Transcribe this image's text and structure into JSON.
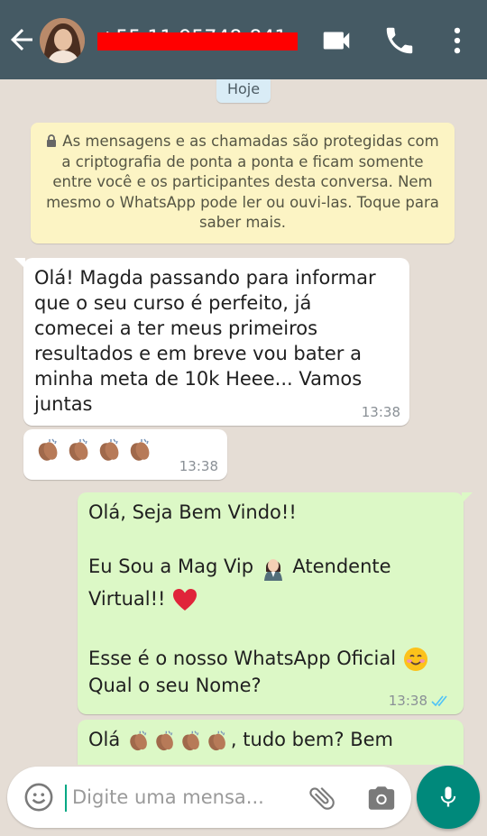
{
  "header": {
    "contact_name": "+55 11 95748-841...",
    "icons": [
      "back-arrow-icon",
      "video-call-icon",
      "phone-icon",
      "more-vert-icon"
    ]
  },
  "chat": {
    "date_chip": "Hoje",
    "encryption_notice": "As mensagens e as chamadas são protegidas com a criptografia de ponta a ponta e ficam somente entre você e os participantes desta conversa. Nem mesmo o WhatsApp pode ler ou ouvi-las. Toque para saber mais.",
    "messages": [
      {
        "direction": "incoming",
        "lines": [
          "Olá! Magda passando para informar",
          "que o seu curso é perfeito, já",
          "comecei a ter meus primeiros",
          "resultados e em breve vou bater a",
          "minha meta de 10k Heee... Vamos",
          "juntas"
        ],
        "time": "13:38"
      },
      {
        "direction": "incoming",
        "emojis": [
          "clapping-hands",
          "clapping-hands",
          "clapping-hands",
          "clapping-hands"
        ],
        "time": "13:38"
      },
      {
        "direction": "outgoing",
        "line1": "Olá, Seja Bem Vindo!!",
        "line2a": "Eu Sou a Mag Vip ",
        "line2b": " Atendente",
        "line3": "Virtual!! ",
        "line4": "Esse é o nosso WhatsApp Oficial ",
        "line5": "Qual o seu Nome?",
        "time": "13:38",
        "status": "read"
      },
      {
        "direction": "outgoing",
        "prefix": "Olá ",
        "suffix": ", tudo bem? Bem"
      }
    ]
  },
  "composer": {
    "placeholder": "Digite uma mensa..."
  },
  "colors": {
    "header": "#455a64",
    "chat_bg": "#e5ddd5",
    "outgoing_bubble": "#dcf8c6",
    "notice_bg": "#fcf4c4",
    "mic_button": "#00897b",
    "read_ticks": "#4fc3f7"
  }
}
